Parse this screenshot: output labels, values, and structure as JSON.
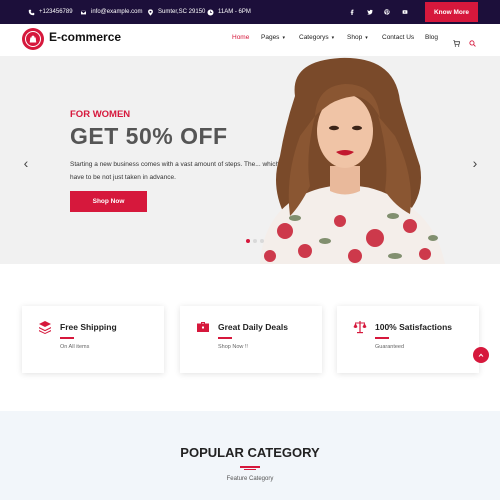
{
  "topbar": {
    "phone": "+123456789",
    "email": "info@example.com",
    "address": "Sumter,SC 29150",
    "hours": "11AM - 6PM",
    "social": [
      "facebook-icon",
      "twitter-icon",
      "pinterest-icon",
      "youtube-icon"
    ],
    "know_more": "Know More"
  },
  "header": {
    "brand": "E-commerce",
    "nav": {
      "home": "Home",
      "pages": "Pages",
      "categorys": "Categorys",
      "shop": "Shop",
      "contact": "Contact Us",
      "blog": "Blog"
    }
  },
  "hero": {
    "subtitle": "FOR WOMEN",
    "title": "GET 50% OFF",
    "description": "Starting a new business comes with a vast amount of steps. The... which have to be not just taken in advance.",
    "button": "Shop Now",
    "active_slide": 1,
    "slide_count": 3
  },
  "features": [
    {
      "title": "Free Shipping",
      "subtitle": "On All items",
      "icon": "layers-icon"
    },
    {
      "title": "Great Daily Deals",
      "subtitle": "Shop Now !!",
      "icon": "briefcase-icon"
    },
    {
      "title": "100% Satisfactions",
      "subtitle": "Guaranteed",
      "icon": "scale-icon"
    }
  ],
  "popular": {
    "title": "POPULAR CATEGORY",
    "subtitle": "Feature Category"
  },
  "colors": {
    "accent": "#d6183c",
    "topbar": "#1c0f3a",
    "hero_bg": "#f1f1f1",
    "section_bg": "#f2f6fa"
  }
}
